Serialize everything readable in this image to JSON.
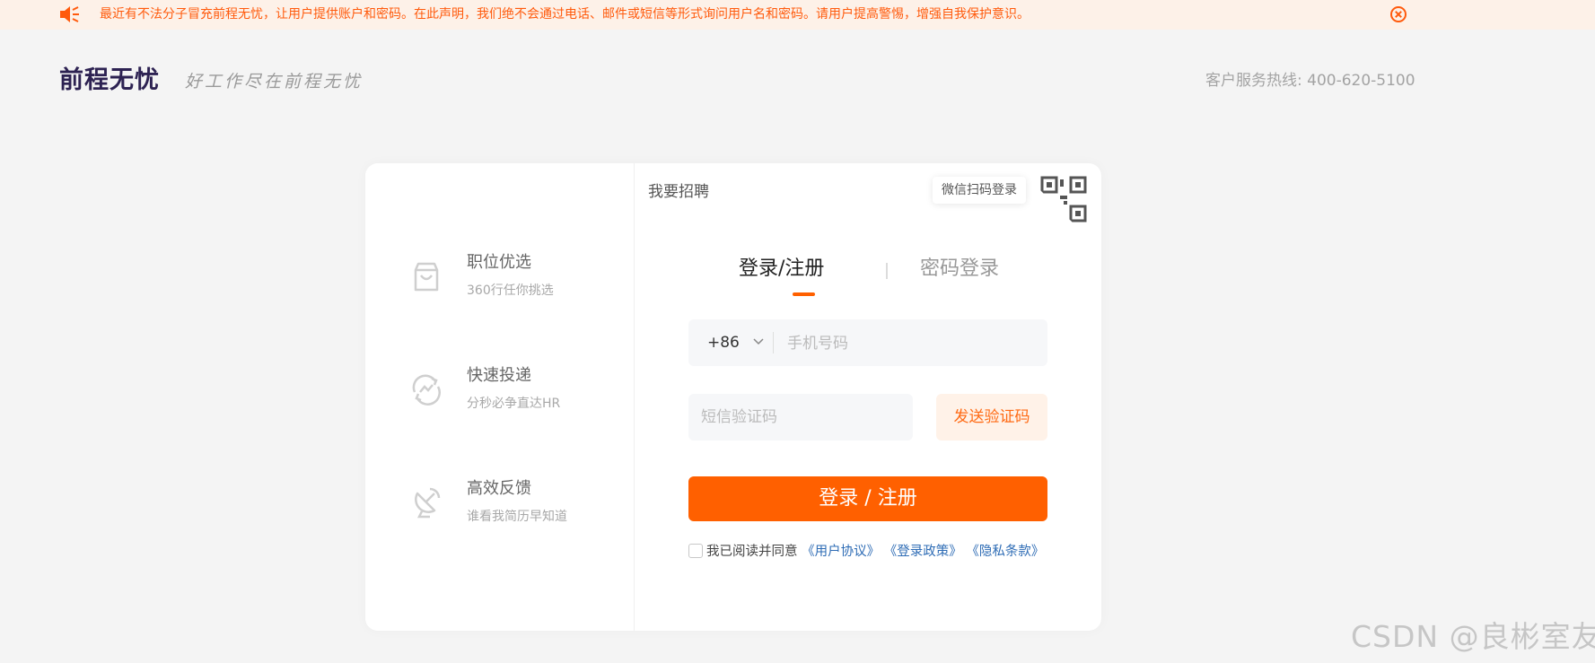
{
  "banner": {
    "notice": "最近有不法分子冒充前程无忧，让用户提供账户和密码。在此声明，我们绝不会通过电话、邮件或短信等形式询问用户名和密码。请用户提高警惕，增强自我保护意识。",
    "speaker_icon": "speaker-icon",
    "close_icon": "close-circle-icon",
    "color": "#ff5a0c"
  },
  "header": {
    "logo": "前程无忧",
    "slogan": "好工作尽在前程无忧",
    "hotline": "客户服务热线: 400-620-5100"
  },
  "features": [
    {
      "icon": "shopping-bag-icon",
      "title": "职位优选",
      "subtitle": "360行任你挑选"
    },
    {
      "icon": "refresh-chart-icon",
      "title": "快速投递",
      "subtitle": "分秒必争直达HR"
    },
    {
      "icon": "satellite-dish-icon",
      "title": "高效反馈",
      "subtitle": "谁看我简历早知道"
    }
  ],
  "login": {
    "recruit_link": "我要招聘",
    "wechat_tip": "微信扫码登录",
    "qr_icon": "qr-code-icon",
    "tabs": [
      {
        "label": "登录/注册",
        "active": true
      },
      {
        "label": "密码登录",
        "active": false
      }
    ],
    "country_code": "+86",
    "phone_placeholder": "手机号码",
    "sms_placeholder": "短信验证码",
    "send_code": "发送验证码",
    "submit": "登录 / 注册",
    "agreement": {
      "prefix": "我已阅读并同意",
      "links": [
        "《用户协议》",
        "《登录政策》",
        "《隐私条款》"
      ]
    },
    "accent": "#ff6000"
  },
  "watermark": "CSDN @良彬室友"
}
